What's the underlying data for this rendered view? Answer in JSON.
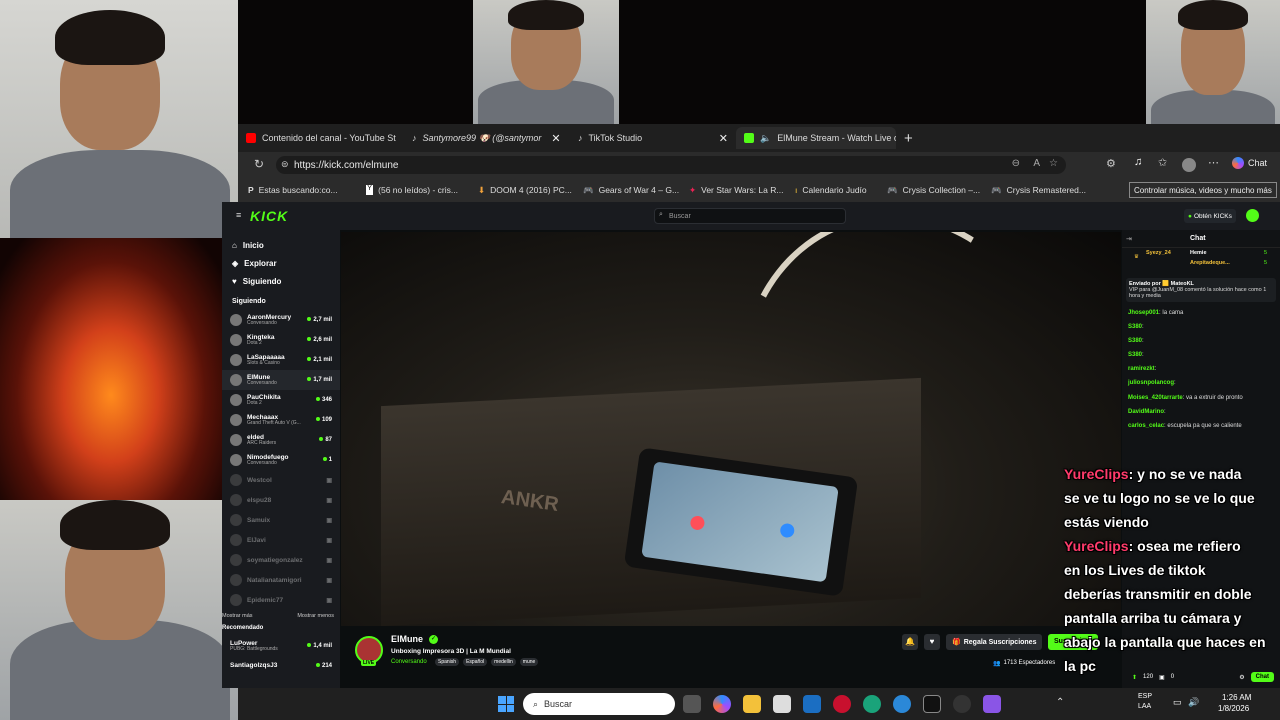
{
  "browser": {
    "tabs": [
      {
        "label": "Contenido del canal - YouTube St",
        "favicon_color": "#ff0000"
      },
      {
        "label": "Santymore99 🐶 (@santymor",
        "favicon_color": "#111111"
      },
      {
        "label": "TikTok Studio",
        "favicon_color": "#111111"
      },
      {
        "label": "ElMune Stream - Watch Live o",
        "favicon_color": "#53fc18",
        "active": true
      }
    ],
    "new_tab": "+",
    "url": "https://kick.com/elmune",
    "chat_button": "Chat",
    "tooltip": "Controlar música, videos y mucho más",
    "bookmarks": [
      {
        "label": "Estas buscando:co...",
        "icon": "p-icon"
      },
      {
        "label": "(56 no leídos) - cris...",
        "icon": "yahoo-icon"
      },
      {
        "label": "DOOM 4 (2016) PC...",
        "icon": "download-icon"
      },
      {
        "label": "Gears of War 4 – G...",
        "icon": "controller-icon"
      },
      {
        "label": "Ver Star Wars: La R...",
        "icon": "starwars-icon"
      },
      {
        "label": "Calendario Judío",
        "icon": "candle-icon"
      },
      {
        "label": "Crysis Collection –...",
        "icon": "controller-icon"
      },
      {
        "label": "Crysis Remastered...",
        "icon": "controller-icon"
      }
    ]
  },
  "kick": {
    "logo": "KICK",
    "search_placeholder": "Buscar",
    "get_kicks": "Obtén KICKs",
    "nav": [
      {
        "label": "Inicio",
        "icon": "home-icon"
      },
      {
        "label": "Explorar",
        "icon": "compass-icon"
      },
      {
        "label": "Siguiendo",
        "icon": "heart-icon"
      }
    ],
    "following_title": "Siguiendo",
    "following": [
      {
        "name": "AaronMercury",
        "game": "Conversando",
        "viewers": "2,7 mil"
      },
      {
        "name": "Kingteka",
        "game": "Dota 2",
        "viewers": "2,6 mil"
      },
      {
        "name": "LaSapaaaaa",
        "game": "Slots & Casino",
        "viewers": "2,1 mil"
      },
      {
        "name": "ElMune",
        "game": "Conversando",
        "viewers": "1,7 mil"
      },
      {
        "name": "PauChikita",
        "game": "Dota 2",
        "viewers": "346"
      },
      {
        "name": "Mechaaax",
        "game": "Grand Theft Auto V (G...",
        "viewers": "109"
      },
      {
        "name": "elded",
        "game": "ARC Raiders",
        "viewers": "87"
      },
      {
        "name": "Nimodefuego",
        "game": "Conversando",
        "viewers": "1"
      }
    ],
    "offline": [
      "Westcol",
      "elspu28",
      "Samuix",
      "ElJavi",
      "soymatiegonzalez",
      "Natalianatamigori",
      "Epidemic77"
    ],
    "show_less": "Mostrar menos",
    "show_more": "Mostrar más",
    "recommended_title": "Recomendado",
    "recommended": [
      {
        "name": "LuPower",
        "game": "PUBG: Battlegrounds",
        "viewers": "1,4 mil"
      },
      {
        "name": "SantiagolzqsJ3",
        "game": "",
        "viewers": "214"
      }
    ],
    "stream": {
      "channel": "ElMune",
      "title": "Unboxing Impresora 3D | La M Mundial",
      "category": "Conversando",
      "tags": [
        "Spanish",
        "Español",
        "medellin",
        "mune"
      ],
      "subscribe_gift": "Regala Suscripciones",
      "subscribe": "Suscribirse",
      "viewers": "1713 Espectadores",
      "live_badge": "LIVE"
    },
    "chat": {
      "title": "Chat",
      "top_gifters": [
        {
          "name": "Syezy_24",
          "count": "5"
        },
        {
          "name": "Hemie",
          "count": "5"
        },
        {
          "name": "Arepitadeque...",
          "count": "5"
        }
      ],
      "pinned_by": "Enviado por 🟨 MateoKL",
      "pinned_text": "VIP para @JuanM_08 comentó la solución hace como 1 hora y media",
      "messages": [
        {
          "user": "Jhosep001",
          "text": "la cama"
        },
        {
          "user": "S380",
          "text": ""
        },
        {
          "user": "S380",
          "text": ""
        },
        {
          "user": "S380",
          "text": ""
        },
        {
          "user": "ramirezkt",
          "text": ""
        },
        {
          "user": "juliosnpolancog",
          "text": ""
        },
        {
          "user": "Moises_420tarrarte",
          "text": "va a extruir de pronto"
        },
        {
          "user": "DavidMarino",
          "text": ""
        },
        {
          "user": "carlos_celac",
          "text": "escupela pa que se caliente"
        }
      ],
      "points": "120",
      "points2": "0",
      "chat_button": "Chat"
    }
  },
  "captions": [
    {
      "user": "YureClips",
      "text": ": y no se ve nada"
    },
    {
      "user": "",
      "text": "se ve tu logo no se ve lo que"
    },
    {
      "user": "",
      "text": "estás viendo"
    },
    {
      "user": "YureClips",
      "text": ": osea me refiero"
    },
    {
      "user": "",
      "text": "en los Lives de tiktok"
    },
    {
      "user": "",
      "text": "deberías transmitir en doble"
    },
    {
      "user": "",
      "text": "pantalla arriba tu cámara y"
    },
    {
      "user": "",
      "text": "abajo la pantalla que haces en"
    },
    {
      "user": "",
      "text": "la pc"
    }
  ],
  "taskbar": {
    "search": "Buscar",
    "language": "ESP",
    "layout": "LAA",
    "time": "1:26 AM",
    "date": "1/8/2026"
  }
}
